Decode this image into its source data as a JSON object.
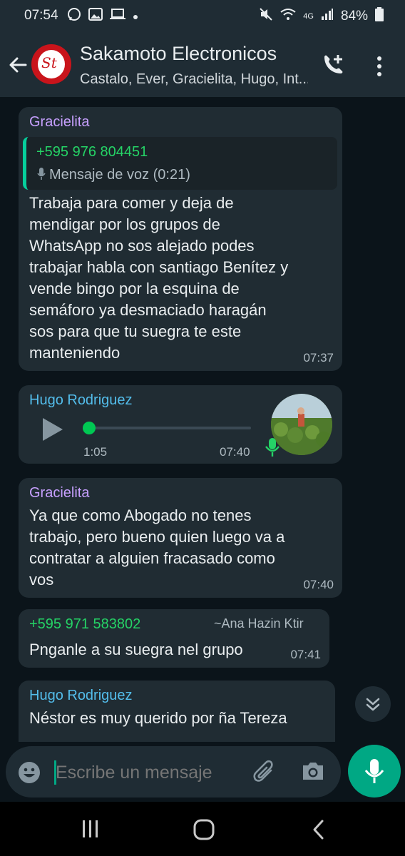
{
  "status_bar": {
    "time": "07:54",
    "battery": "84%",
    "network": "4G"
  },
  "header": {
    "title": "Sakamoto Electronicos",
    "subtitle": "Castalo, Ever, Gracielita, Hugo, Int...",
    "avatar_text": "St"
  },
  "messages": [
    {
      "sender": "Gracielita",
      "sender_color": "#c7a0ff",
      "quote": {
        "number": "+595 976 804451",
        "text": "Mensaje de voz (0:21)"
      },
      "text_lines": [
        "Trabaja para comer y deja de",
        "mendigar por los grupos de",
        "WhatsApp no sos alejado podes",
        "trabajar habla con santiago Benítez y",
        "vende bingo por la esquina de",
        "semáforo ya desmaciado haragán",
        "sos para que tu suegra te este",
        "manteniendo"
      ],
      "time": "07:37"
    },
    {
      "sender": "Hugo Rodriguez",
      "sender_color": "#53bdeb",
      "voice": {
        "duration": "1:05",
        "progress": 0
      },
      "time": "07:40"
    },
    {
      "sender": "Gracielita",
      "sender_color": "#c7a0ff",
      "text_lines": [
        "Ya que como Abogado no tenes",
        "trabajo, pero bueno quien luego va a",
        "contratar a alguien fracasado como",
        "vos"
      ],
      "time": "07:40"
    },
    {
      "sender": "+595 971 583802",
      "sender_color": "#25d366",
      "alias": "~Ana Hazin Ktir",
      "text": "Pnganle a su suegra nel grupo",
      "time": "07:41"
    },
    {
      "sender": "Hugo Rodriguez",
      "sender_color": "#53bdeb",
      "text": "Néstor es muy querido por ña Tereza"
    }
  ],
  "input": {
    "placeholder": "Escribe un mensaje"
  },
  "colors": {
    "accent": "#00a884",
    "bubble": "#202c33",
    "background": "#0b141a",
    "header": "#1f2c34"
  }
}
